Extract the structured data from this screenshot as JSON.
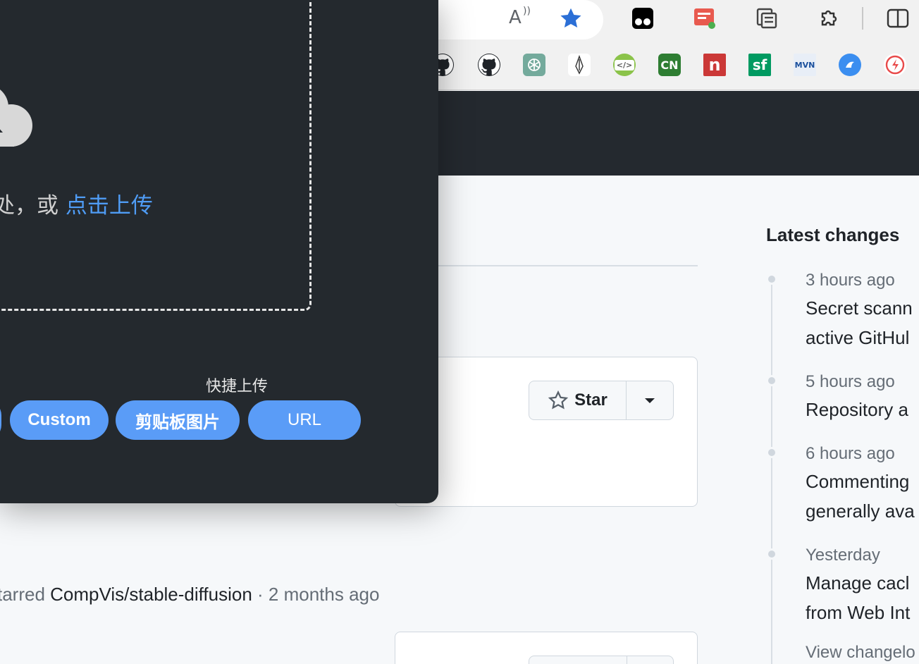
{
  "browser": {
    "toolbar_icons": [
      "read-aloud-icon",
      "favorite-star-icon",
      "tampermonkey-icon",
      "notes-extension-icon",
      "collections-icon",
      "extensions-puzzle-icon",
      "split-screen-icon"
    ],
    "read_aloud_glyph": "A",
    "bookmarks": [
      {
        "name": "github-bookmark-icon",
        "glyph": ""
      },
      {
        "name": "github-bookmark-icon",
        "glyph": ""
      },
      {
        "name": "chatgpt-bookmark-icon",
        "glyph": ""
      },
      {
        "name": "pen-bookmark-icon",
        "glyph": ""
      },
      {
        "name": "code-bookmark-icon",
        "glyph": "</>"
      },
      {
        "name": "cn-bookmark-icon",
        "glyph": "CN"
      },
      {
        "name": "npm-bookmark-icon",
        "glyph": "n"
      },
      {
        "name": "sf-bookmark-icon",
        "glyph": "sf"
      },
      {
        "name": "mvn-bookmark-icon",
        "glyph": "MVN"
      },
      {
        "name": "blue-bird-bookmark-icon",
        "glyph": ""
      },
      {
        "name": "red-bolt-bookmark-icon",
        "glyph": ""
      }
    ]
  },
  "upload_popup": {
    "drop_text_prefix": "处，或 ",
    "drop_text_link": "点击上传",
    "quick_upload_label": "快捷上传",
    "buttons": {
      "custom": "Custom",
      "clipboard": "剪贴板图片",
      "url": "URL"
    }
  },
  "feed": {
    "star_button_label": "Star",
    "activity": {
      "verb": "tarred",
      "repo": "CompVis/stable-diffusion",
      "separator": " · ",
      "time": "2 months ago"
    }
  },
  "latest_changes": {
    "title": "Latest changes",
    "items": [
      {
        "time": "3 hours ago",
        "title": "Secret scann\nactive GitHul"
      },
      {
        "time": "5 hours ago",
        "title": "Repository a"
      },
      {
        "time": "6 hours ago",
        "title": "Commenting\ngenerally ava"
      },
      {
        "time": "Yesterday",
        "title": "Manage cacl\nfrom Web Int"
      }
    ],
    "view_changelog": "View changelo"
  },
  "colors": {
    "popup_bg": "#24292e",
    "accent_blue": "#5a9cf7",
    "link_blue": "#4f9cf5",
    "header_dark": "#24292f"
  }
}
